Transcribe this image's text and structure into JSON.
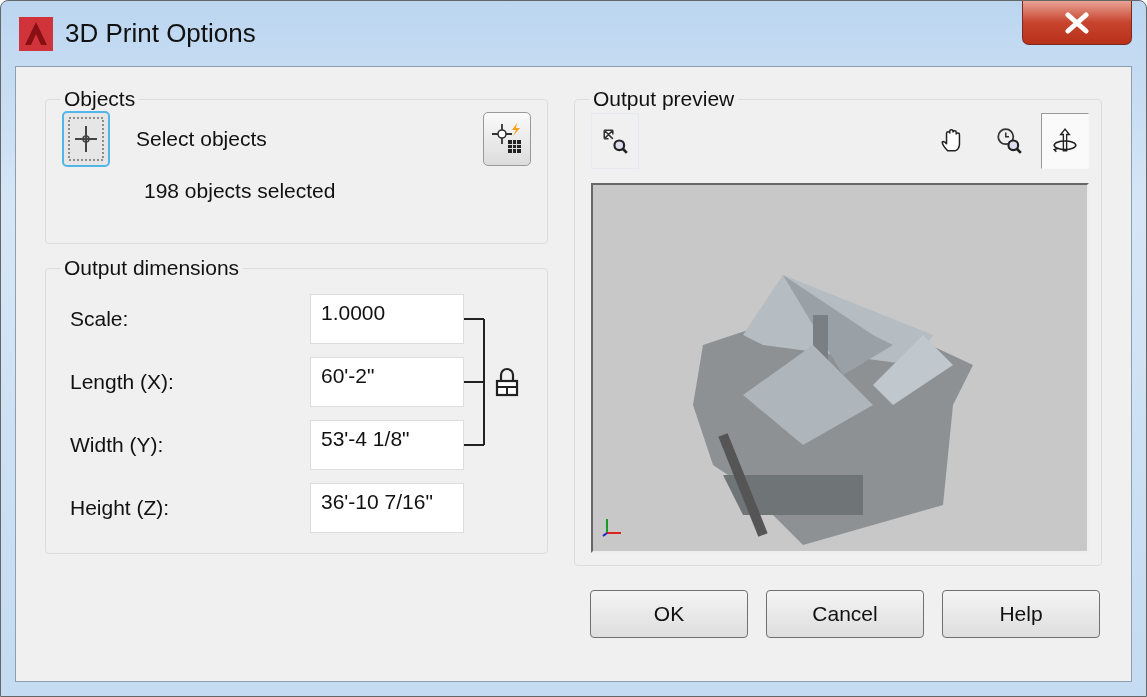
{
  "window": {
    "title": "3D Print Options"
  },
  "objects": {
    "title": "Objects",
    "select_label": "Select objects",
    "count": "198 objects selected"
  },
  "output_dimensions": {
    "title": "Output dimensions",
    "locked": true,
    "fields": [
      {
        "label": "Scale:",
        "value": "1.0000"
      },
      {
        "label": "Length (X):",
        "value": "60'-2\""
      },
      {
        "label": "Width (Y):",
        "value": "53'-4 1/8\""
      },
      {
        "label": "Height (Z):",
        "value": "36'-10 7/16\""
      }
    ]
  },
  "output_preview": {
    "title": "Output preview",
    "tools": [
      {
        "kind": "zoom-extents",
        "selected": false
      },
      {
        "kind": "pan",
        "selected": false
      },
      {
        "kind": "zoom",
        "selected": false
      },
      {
        "kind": "orbit",
        "selected": true
      }
    ]
  },
  "buttons": [
    "OK",
    "Cancel",
    "Help"
  ]
}
